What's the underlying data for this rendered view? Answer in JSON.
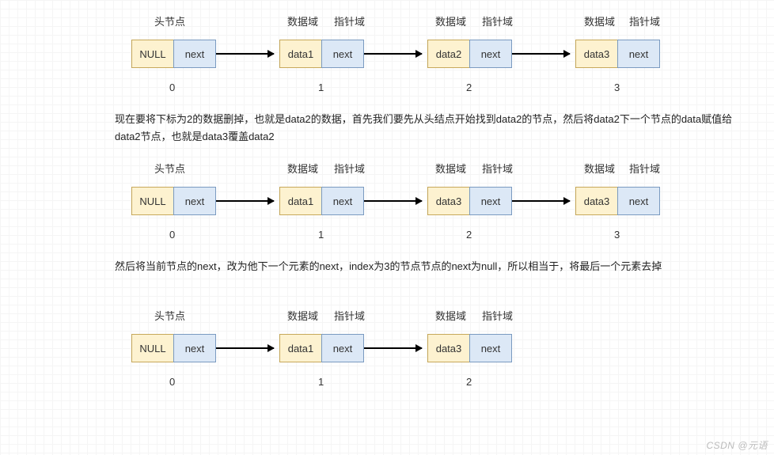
{
  "labels": {
    "head": "头节点",
    "data": "数据域",
    "ptr": "指针域"
  },
  "cells": {
    "null": "NULL",
    "next": "next",
    "d1": "data1",
    "d2": "data2",
    "d3": "data3"
  },
  "idx": {
    "i0": "0",
    "i1": "1",
    "i2": "2",
    "i3": "3"
  },
  "desc1": "现在要将下标为2的数据删掉，也就是data2的数据，首先我们要先从头结点开始找到data2的节点，然后将data2下一个节点的data赋值给data2节点，也就是data3覆盖data2",
  "desc2": "然后将当前节点的next，改为他下一个元素的next，index为3的节点节点的next为null，所以相当于，将最后一个元素去掉",
  "watermark": "CSDN @元语"
}
